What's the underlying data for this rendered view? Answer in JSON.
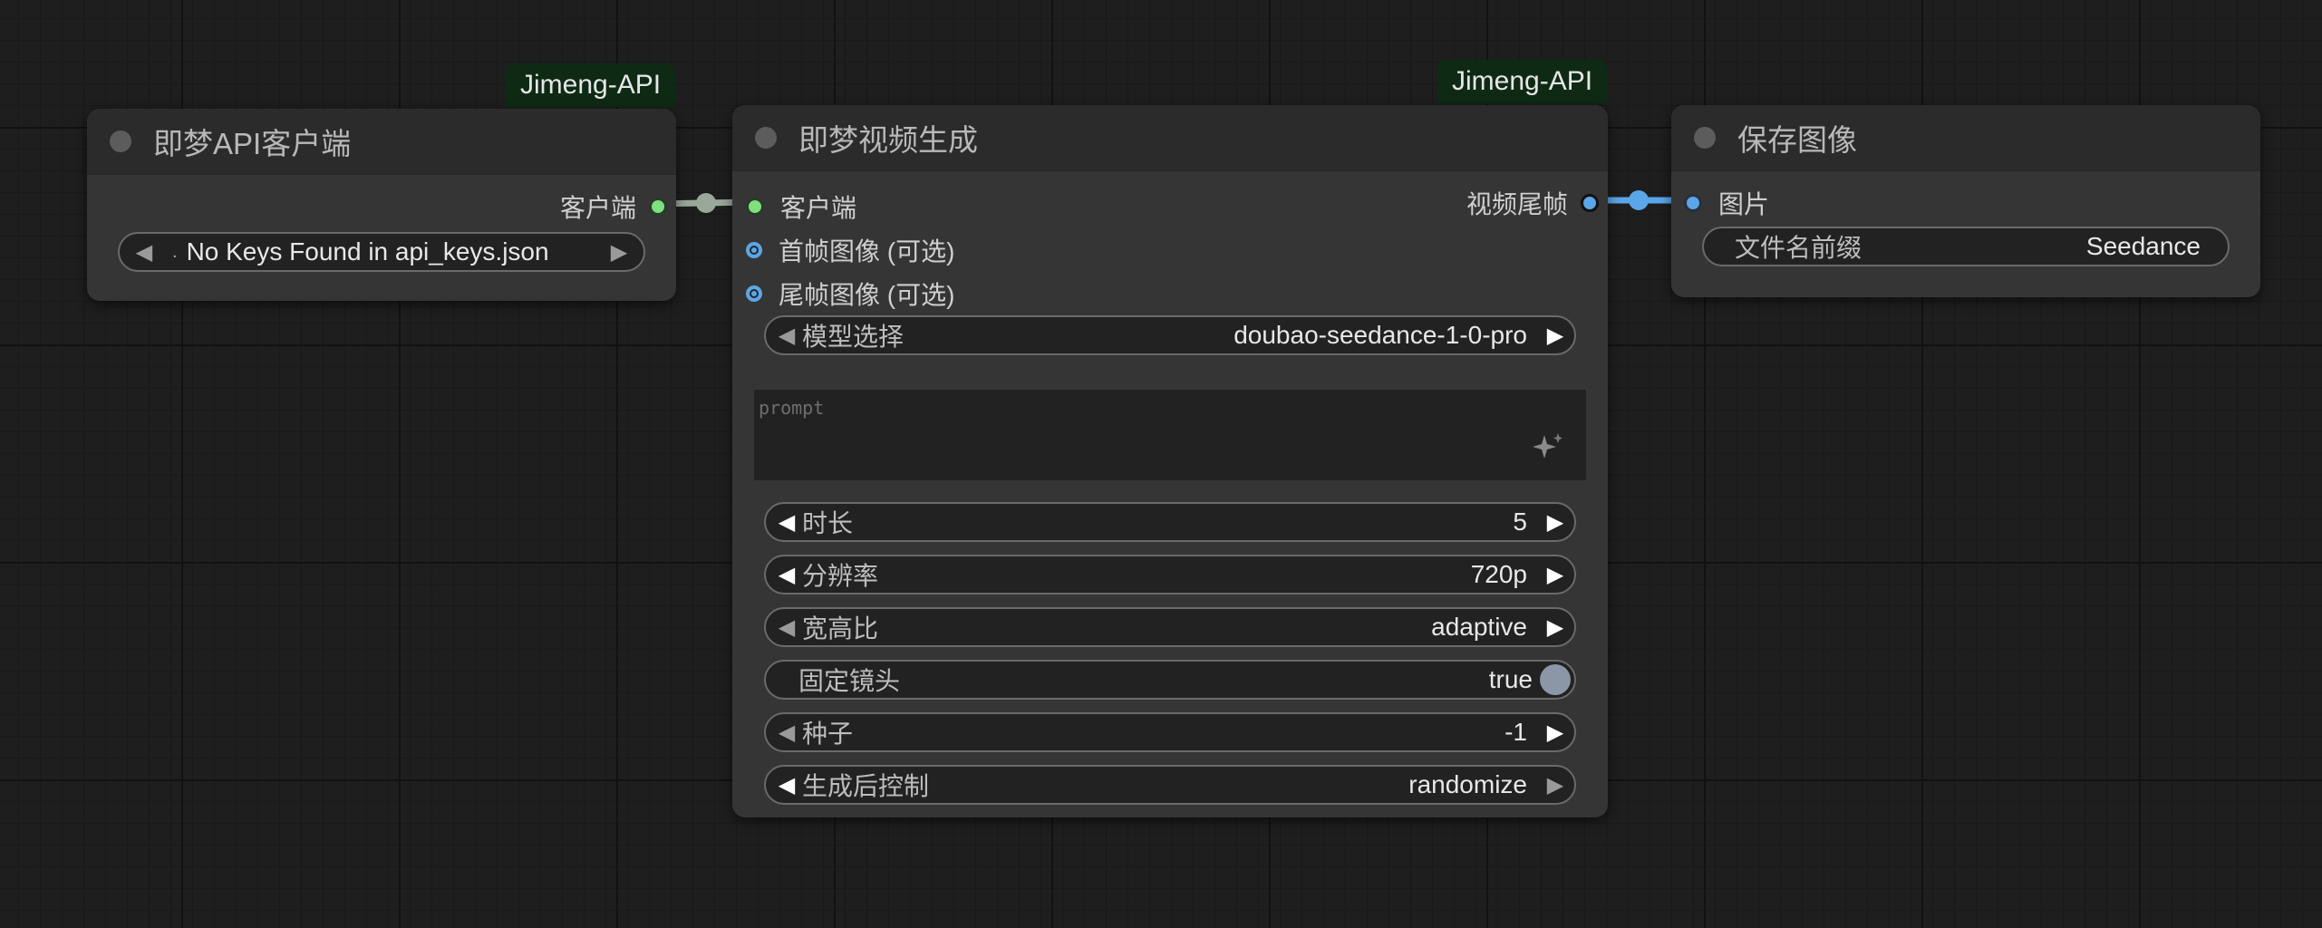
{
  "nodes": {
    "client": {
      "badge": "Jimeng-API",
      "title": "即梦API客户端",
      "output_label": "客户端",
      "api_key_value": "No Keys Found in api_keys.json",
      "api_key_prefix": "."
    },
    "video": {
      "badge": "Jimeng-API",
      "title": "即梦视频生成",
      "inputs": [
        "客户端",
        "首帧图像 (可选)",
        "尾帧图像 (可选)"
      ],
      "output_label": "视频尾帧",
      "widgets": {
        "model": {
          "label": "模型选择",
          "value": "doubao-seedance-1-0-pro"
        },
        "prompt_placeholder": "prompt",
        "duration": {
          "label": "时长",
          "value": "5"
        },
        "resolution": {
          "label": "分辨率",
          "value": "720p"
        },
        "aspect": {
          "label": "宽高比",
          "value": "adaptive"
        },
        "camera_fixed": {
          "label": "固定镜头",
          "value": "true"
        },
        "seed": {
          "label": "种子",
          "value": "-1"
        },
        "control_after": {
          "label": "生成后控制",
          "value": "randomize"
        }
      }
    },
    "save": {
      "title": "保存图像",
      "input_label": "图片",
      "filename_prefix": {
        "label": "文件名前缀",
        "value": "Seedance"
      }
    }
  },
  "colors": {
    "link_client": "#9aa89a",
    "link_image": "#5aa6e8",
    "badge_bg": "#0e2a14"
  },
  "icons": [
    "collapse-dot-icon",
    "sparkle-icon",
    "arrow-left-icon",
    "arrow-right-icon",
    "toggle-knob-icon"
  ]
}
